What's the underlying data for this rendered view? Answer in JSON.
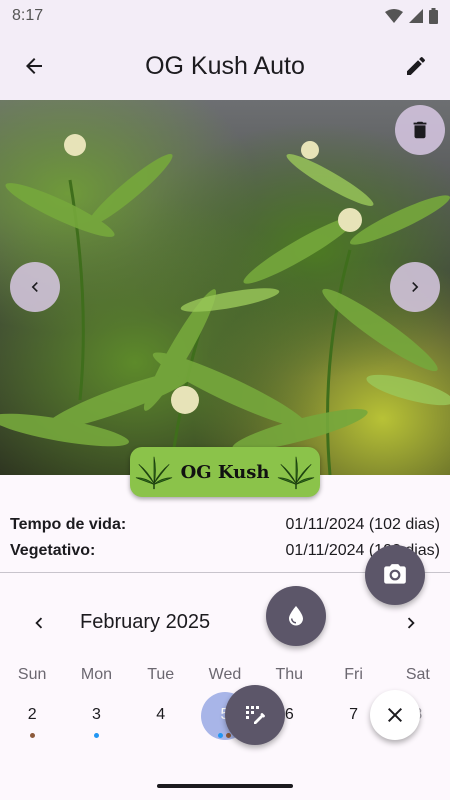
{
  "status_bar": {
    "time": "8:17"
  },
  "app_bar": {
    "title": "OG Kush Auto"
  },
  "plant_badge": {
    "name": "OG Kush"
  },
  "info": [
    {
      "label": "Tempo de vida:",
      "value": "01/11/2024 (102 dias)"
    },
    {
      "label": "Vegetativo:",
      "value": "01/11/2024 (102 dias)"
    }
  ],
  "calendar": {
    "month_label": "February 2025",
    "weekdays": [
      "Sun",
      "Mon",
      "Tue",
      "Wed",
      "Thu",
      "Fri",
      "Sat"
    ],
    "days": [
      "2",
      "3",
      "4",
      "5",
      "6",
      "7",
      "8"
    ],
    "selected_day": "5"
  },
  "icons": {
    "back": "arrow-left-icon",
    "edit": "pencil-icon",
    "delete": "trash-icon",
    "prev_photo": "chevron-left-icon",
    "next_photo": "chevron-right-icon",
    "camera": "camera-icon",
    "water": "water-drop-icon",
    "add_note": "edit-note-icon",
    "close": "close-icon"
  },
  "colors": {
    "app_bar_bg": "#f3edf7",
    "badge_bg": "#8bc34a",
    "fab_dark": "#5c5669",
    "selected_day": "#a8b5e8",
    "dot_brown": "#8d5a3b",
    "dot_blue": "#2196f3"
  }
}
